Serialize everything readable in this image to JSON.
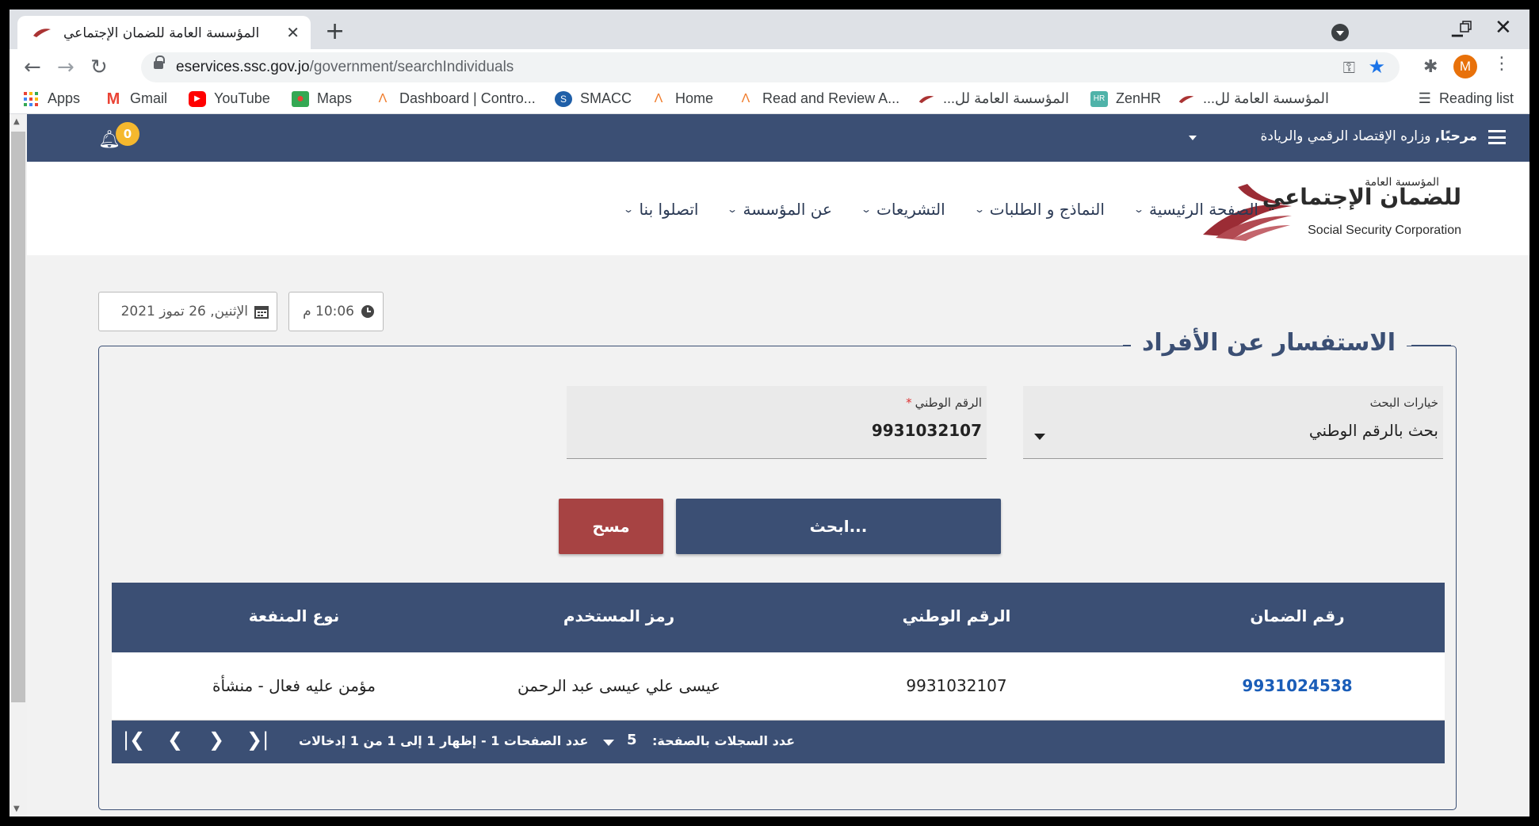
{
  "browser": {
    "tab_title": "المؤسسة العامة للضمان الإجتماعي",
    "tab_close": "✕",
    "new_tab": "+",
    "url_host": "eservices.ssc.gov.jo",
    "url_path": "/government/searchIndividuals",
    "avatar_letter": "M",
    "bookmarks": [
      {
        "label": "Apps",
        "icon": "apps-grid-icon"
      },
      {
        "label": "Gmail",
        "icon": "gmail-icon"
      },
      {
        "label": "YouTube",
        "icon": "youtube-icon"
      },
      {
        "label": "Maps",
        "icon": "maps-icon"
      },
      {
        "label": "Dashboard | Contro...",
        "icon": "a-logo-icon"
      },
      {
        "label": "SMACC",
        "icon": "smacc-icon"
      },
      {
        "label": "Home",
        "icon": "a-logo-icon"
      },
      {
        "label": "Read and Review A...",
        "icon": "a-logo-icon"
      },
      {
        "label": "المؤسسة العامة لل...",
        "icon": "ssc-bird-icon"
      },
      {
        "label": "ZenHR",
        "icon": "zenhr-icon"
      },
      {
        "label": "المؤسسة العامة لل...",
        "icon": "ssc-bird-icon"
      }
    ],
    "reading_list": "Reading list"
  },
  "topbar": {
    "welcome_bold": "مرحبًا,",
    "welcome_name": "وزاره الإقتصاد الرقمي والريادة",
    "notif_count": "0"
  },
  "logo": {
    "ar_small": "المؤسسة العامة",
    "ar_main": "للضمان الإجتماعي",
    "en": "Social Security Corporation"
  },
  "nav": {
    "home": "الصفحة الرئيسية",
    "forms": "النماذج و الطلبات",
    "legislation": "التشريعات",
    "about": "عن المؤسسة",
    "contact": "اتصلوا بنا"
  },
  "datetime": {
    "time": "10:06 م",
    "date": "الإثنين, 26 تموز 2021"
  },
  "panel": {
    "title": "الاستفسار عن الأفراد",
    "search_option_label": "خيارات البحث",
    "search_option_value": "بحث بالرقم الوطني",
    "national_id_label": "الرقم الوطني",
    "required_mark": "*",
    "national_id_value": "9931032107",
    "search_button": "ابحث...",
    "clear_button": "مسح"
  },
  "table": {
    "headers": [
      "رقم الضمان",
      "الرقم الوطني",
      "رمز المستخدم",
      "نوع المنفعة"
    ],
    "rows": [
      [
        "9931024538",
        "9931032107",
        "عيسى علي عيسى عبد الرحمن",
        "مؤمن عليه فعال - منشأة"
      ]
    ],
    "page_size_label": "عدد السجلات بالصفحة:",
    "page_size": "5",
    "page_info": "عدد الصفحات 1 - إظهار 1 إلى 1 من 1 إدخالات"
  },
  "colors": {
    "primary": "#3b4f74",
    "danger": "#a74343",
    "badge": "#f5b82e",
    "link": "#1a5db8"
  }
}
